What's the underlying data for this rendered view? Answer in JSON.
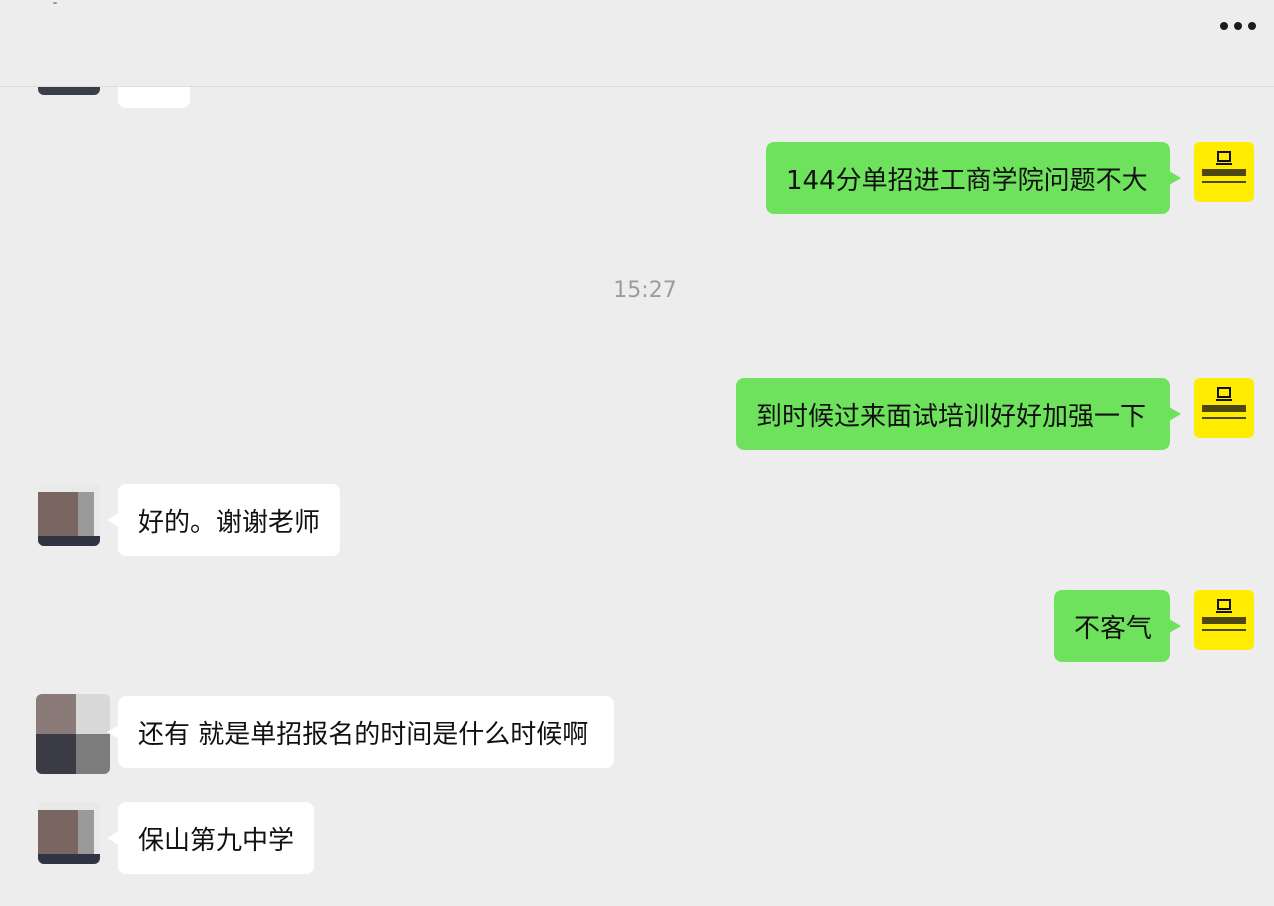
{
  "header": {
    "more_icon": "more-horizontal-icon"
  },
  "messages": [
    {
      "side": "in",
      "text": ""
    },
    {
      "side": "out",
      "text": "144分单招进工商学院问题不大"
    },
    {
      "side": "out",
      "text": "到时候过来面试培训好好加强一下"
    },
    {
      "side": "in",
      "text": "好的。谢谢老师"
    },
    {
      "side": "out",
      "text": "不客气"
    },
    {
      "side": "in",
      "text": "还有 就是单招报名的时间是什么时候啊"
    },
    {
      "side": "in",
      "text": "保山第九中学"
    }
  ],
  "timestamp": "15:27",
  "colors": {
    "background": "#ededed",
    "outgoing_bubble": "#6ee25c",
    "incoming_bubble": "#ffffff",
    "brand_avatar": "#ffec00"
  }
}
